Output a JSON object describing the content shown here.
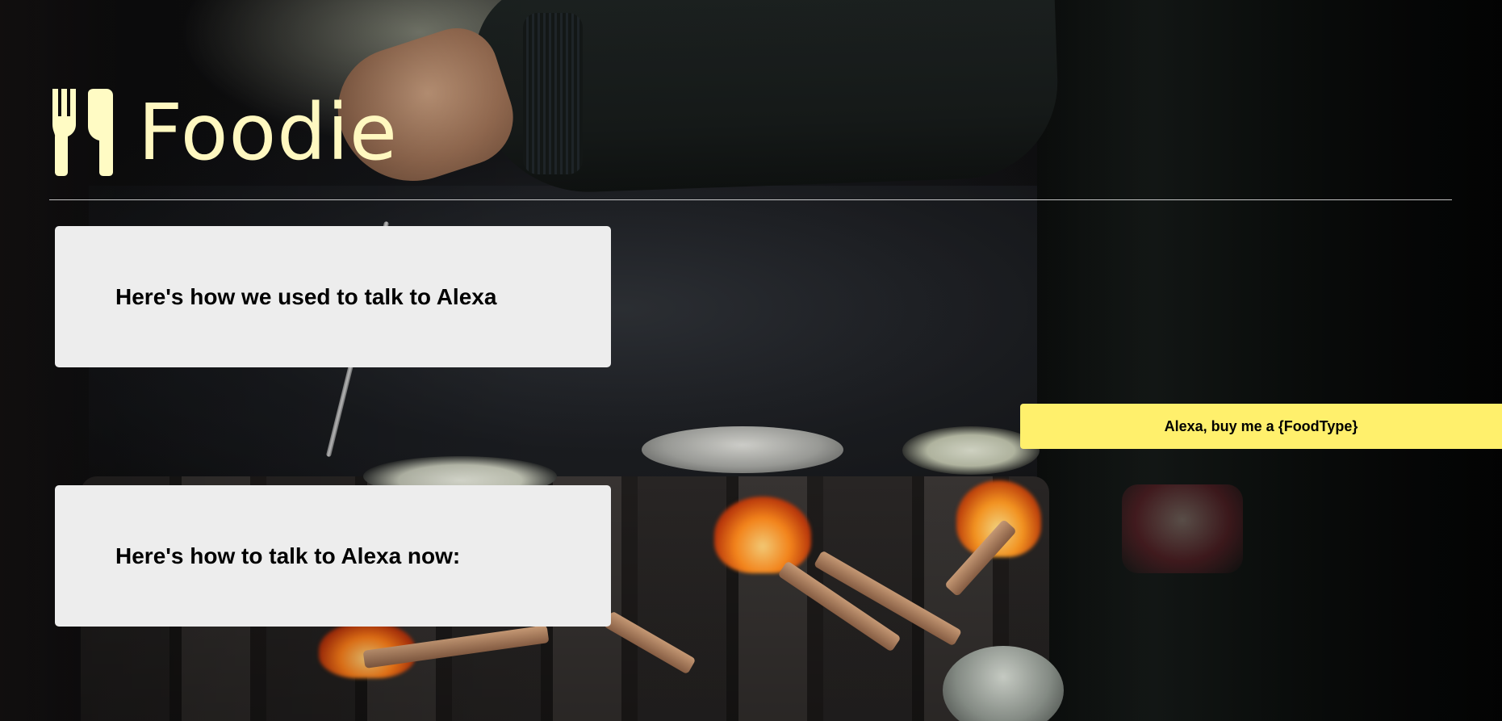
{
  "brand": {
    "name": "Foodie",
    "logo_icon": "fork-knife-icon",
    "color": "#fff8c0"
  },
  "cards": {
    "old_way_title": "Here's how we used to talk to Alexa",
    "new_way_title": "Here's how to talk to Alexa now:"
  },
  "command": {
    "text": "Alexa, buy me a {FoodType}",
    "background": "#fff06c"
  },
  "colors": {
    "card_background": "#ededed",
    "divider": "#ffffff"
  }
}
